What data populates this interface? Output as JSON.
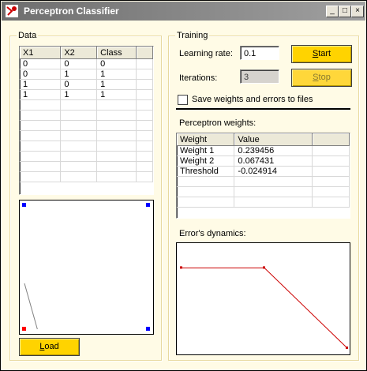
{
  "window": {
    "title": "Perceptron Classifier",
    "minimize": "_",
    "maximize": "□",
    "close": "×"
  },
  "data_group": {
    "label": "Data",
    "columns": [
      "X1",
      "X2",
      "Class"
    ],
    "rows": [
      [
        "0",
        "0",
        "0"
      ],
      [
        "0",
        "1",
        "1"
      ],
      [
        "1",
        "0",
        "1"
      ],
      [
        "1",
        "1",
        "1"
      ]
    ],
    "load_button": {
      "label": "Load",
      "accel": "L",
      "rest": "oad"
    }
  },
  "training_group": {
    "label": "Training",
    "learning_rate_label": "Learning rate:",
    "learning_rate_value": "0.1",
    "iterations_label": "Iterations:",
    "iterations_value": "3",
    "start_button": {
      "accel": "S",
      "rest": "tart"
    },
    "stop_button": {
      "accel": "S",
      "rest": "top"
    },
    "save_checkbox_label": "Save weights and errors to files",
    "save_checked": false,
    "weights_label": "Perceptron weights:",
    "weights_columns": [
      "Weight",
      "Value"
    ],
    "weights_rows": [
      [
        "Weight 1",
        "0.239456"
      ],
      [
        "Weight 2",
        "0.067431"
      ],
      [
        "Threshold",
        "-0.024914"
      ]
    ],
    "errors_label": "Error's dynamics:"
  },
  "scatter": {
    "points": [
      {
        "x": 0,
        "y": 0,
        "class": 0
      },
      {
        "x": 0,
        "y": 1,
        "class": 1
      },
      {
        "x": 1,
        "y": 0,
        "class": 1
      },
      {
        "x": 1,
        "y": 1,
        "class": 1
      }
    ],
    "colors": {
      "class0": "#ff0000",
      "class1": "#0000ff",
      "line": "#808080"
    }
  },
  "error_chart": {
    "values": [
      1,
      1,
      0
    ],
    "color": "#cc0000"
  }
}
